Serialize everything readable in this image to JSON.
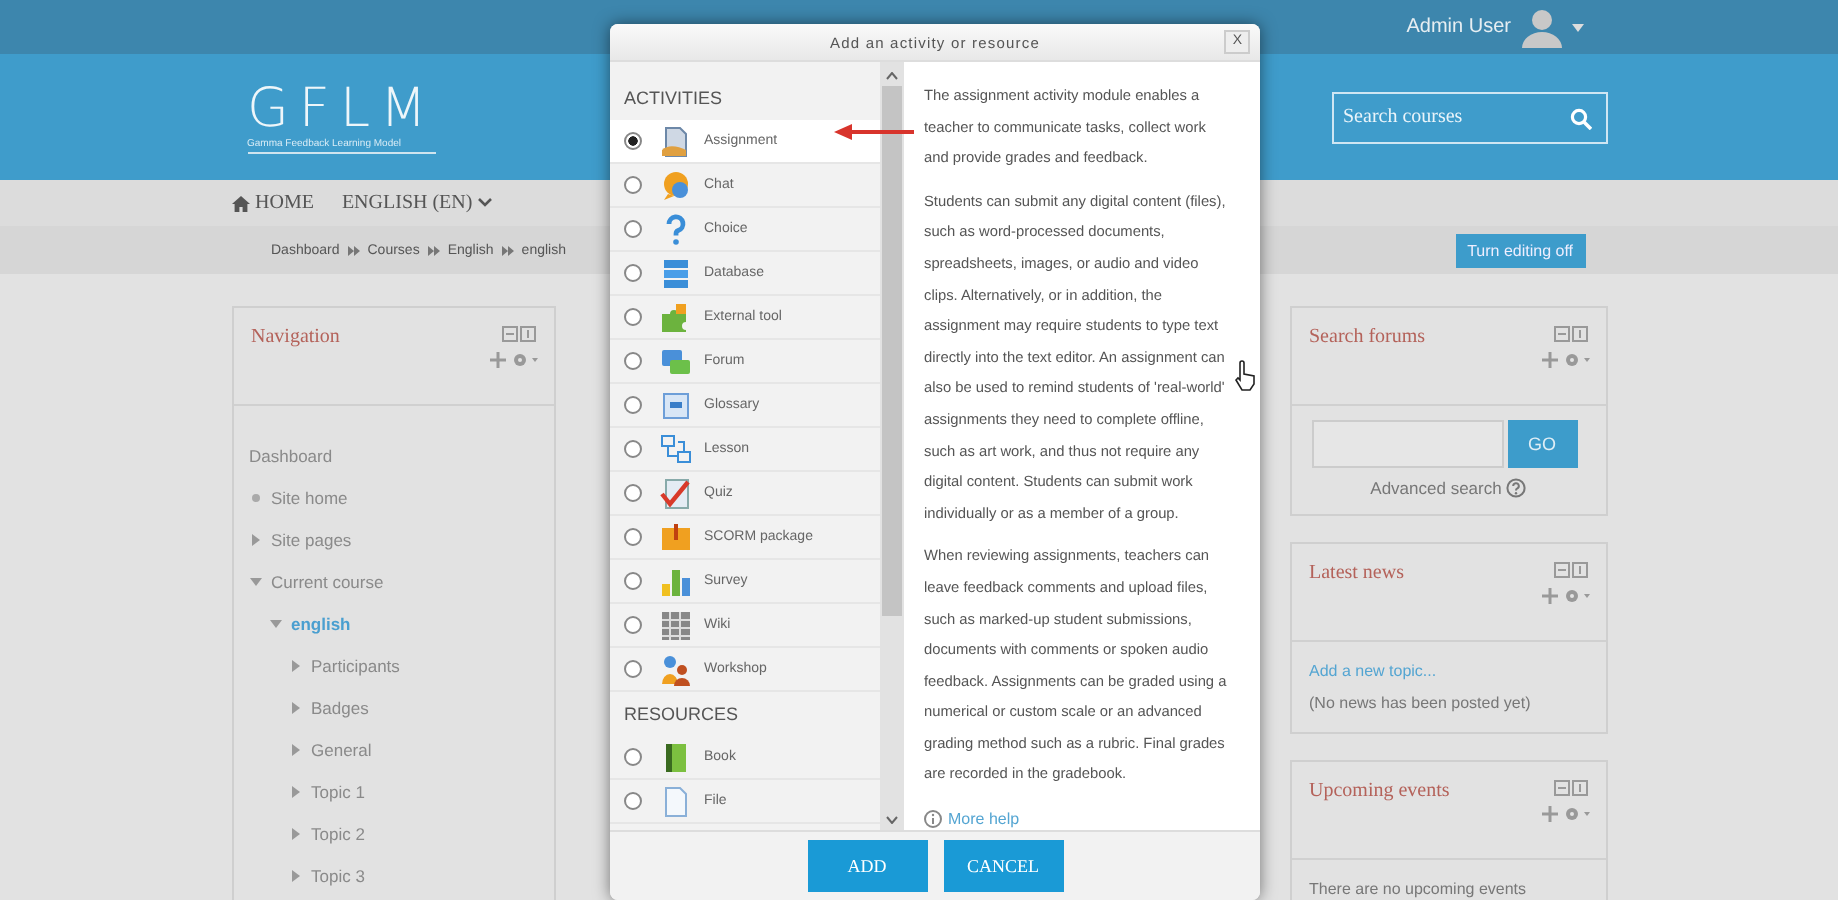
{
  "top_bar": {
    "user_name": "Admin User"
  },
  "header": {
    "logo_title": "GFLM",
    "logo_subtitle": "Gamma Feedback Learning Model",
    "search": {
      "placeholder": "Search courses"
    }
  },
  "nav_menu": [
    {
      "label": "HOME",
      "kind": "home"
    },
    {
      "label": "ENGLISH (EN)",
      "kind": "dropdown"
    }
  ],
  "breadcrumb": [
    "Dashboard",
    "Courses",
    "English",
    "english"
  ],
  "edit_button": "Turn editing off",
  "navigation_block": {
    "title": "Navigation",
    "items": [
      {
        "label": "Dashboard",
        "kind": "root",
        "children": [
          {
            "label": "Site home",
            "kind": "leaf"
          },
          {
            "label": "Site pages",
            "kind": "branch",
            "expanded": false
          },
          {
            "label": "Current course",
            "kind": "branch",
            "expanded": true,
            "children": [
              {
                "label": "english",
                "kind": "branch",
                "expanded": true,
                "current": true,
                "children": [
                  {
                    "label": "Participants",
                    "kind": "branch",
                    "expanded": false
                  },
                  {
                    "label": "Badges",
                    "kind": "branch",
                    "expanded": false
                  },
                  {
                    "label": "General",
                    "kind": "branch",
                    "expanded": false
                  },
                  {
                    "label": "Topic 1",
                    "kind": "branch",
                    "expanded": false
                  },
                  {
                    "label": "Topic 2",
                    "kind": "branch",
                    "expanded": false
                  },
                  {
                    "label": "Topic 3",
                    "kind": "branch",
                    "expanded": false
                  }
                ]
              }
            ]
          }
        ]
      }
    ]
  },
  "search_forums_block": {
    "title": "Search forums",
    "button": "GO",
    "advanced_link": "Advanced search"
  },
  "latest_news_block": {
    "title": "Latest news",
    "link": "Add a new topic...",
    "text": "(No news has been posted yet)"
  },
  "upcoming_events_block": {
    "title": "Upcoming events",
    "text": "There are no upcoming events"
  },
  "modal": {
    "title": "Add an activity or resource",
    "close": "X",
    "sections": [
      {
        "heading": "ACTIVITIES",
        "items": [
          {
            "label": "Assignment",
            "selected": true
          },
          {
            "label": "Chat",
            "selected": false
          },
          {
            "label": "Choice",
            "selected": false
          },
          {
            "label": "Database",
            "selected": false
          },
          {
            "label": "External tool",
            "selected": false
          },
          {
            "label": "Forum",
            "selected": false
          },
          {
            "label": "Glossary",
            "selected": false
          },
          {
            "label": "Lesson",
            "selected": false
          },
          {
            "label": "Quiz",
            "selected": false
          },
          {
            "label": "SCORM package",
            "selected": false
          },
          {
            "label": "Survey",
            "selected": false
          },
          {
            "label": "Wiki",
            "selected": false
          },
          {
            "label": "Workshop",
            "selected": false
          }
        ]
      },
      {
        "heading": "RESOURCES",
        "items": [
          {
            "label": "Book",
            "selected": false
          },
          {
            "label": "File",
            "selected": false
          }
        ]
      }
    ],
    "description": [
      "The assignment activity module enables a teacher to communicate tasks, collect work and provide grades and feedback.",
      "Students can submit any digital content (files), such as word-processed documents, spreadsheets, images, or audio and video clips. Alternatively, or in addition, the assignment may require students to type text directly into the text editor. An assignment can also be used to remind students of 'real-world' assignments they need to complete offline, such as art work, and thus not require any digital content. Students can submit work individually or as a member of a group.",
      "When reviewing assignments, teachers can leave feedback comments and upload files, such as marked-up student submissions, documents with comments or spoken audio feedback. Assignments can be graded using a numerical or custom scale or an advanced grading method such as a rubric. Final grades are recorded in the gradebook."
    ],
    "help_link": "More help",
    "buttons": [
      "ADD",
      "CANCEL"
    ]
  }
}
